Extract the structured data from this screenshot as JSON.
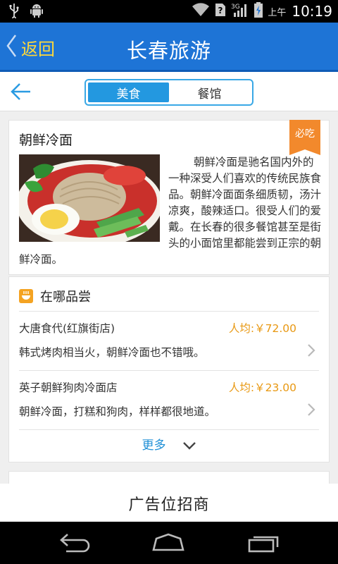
{
  "status_bar": {
    "am_pm": "上午",
    "time": "10:19",
    "network": "3G",
    "icons": [
      "usb-icon",
      "android-debug-icon",
      "wifi-icon",
      "sim-unknown-icon",
      "signal-icon",
      "battery-charging-icon"
    ]
  },
  "header": {
    "back_label": "返回",
    "title": "长春旅游",
    "accent_color": "#1e74d6",
    "back_label_color": "#ffd83a"
  },
  "toolbar": {
    "back_icon": "arrow-left-icon",
    "tabs": [
      {
        "label": "美食",
        "active": true
      },
      {
        "label": "餐馆",
        "active": false
      }
    ]
  },
  "food": {
    "name": "朝鲜冷面",
    "badge": "必吃",
    "description": "朝鲜冷面是驰名国内外的一种深受人们喜欢的传统民族食品。朝鲜冷面面条细质韧，汤汁凉爽，酸辣适口。很受人们的爱戴。在长春的很多餐馆甚至是街头的小面馆里都能尝到正宗的朝鲜冷面。"
  },
  "where": {
    "title": "在哪品尝",
    "icon": "bowl-icon",
    "restaurants": [
      {
        "name": "大唐食代(红旗街店)",
        "price": "人均:￥72.00",
        "comment": "韩式烤肉相当火，朝鲜冷面也不错哦。"
      },
      {
        "name": "英子朝鲜狗肉冷面店",
        "price": "人均:￥23.00",
        "comment": "朝鲜冷面，打糕和狗肉，样样都很地道。"
      }
    ],
    "more_label": "更多"
  },
  "ad": {
    "text": "广告位招商"
  },
  "nav": {
    "buttons": [
      "back-nav-icon",
      "home-nav-icon",
      "recent-apps-icon"
    ]
  }
}
